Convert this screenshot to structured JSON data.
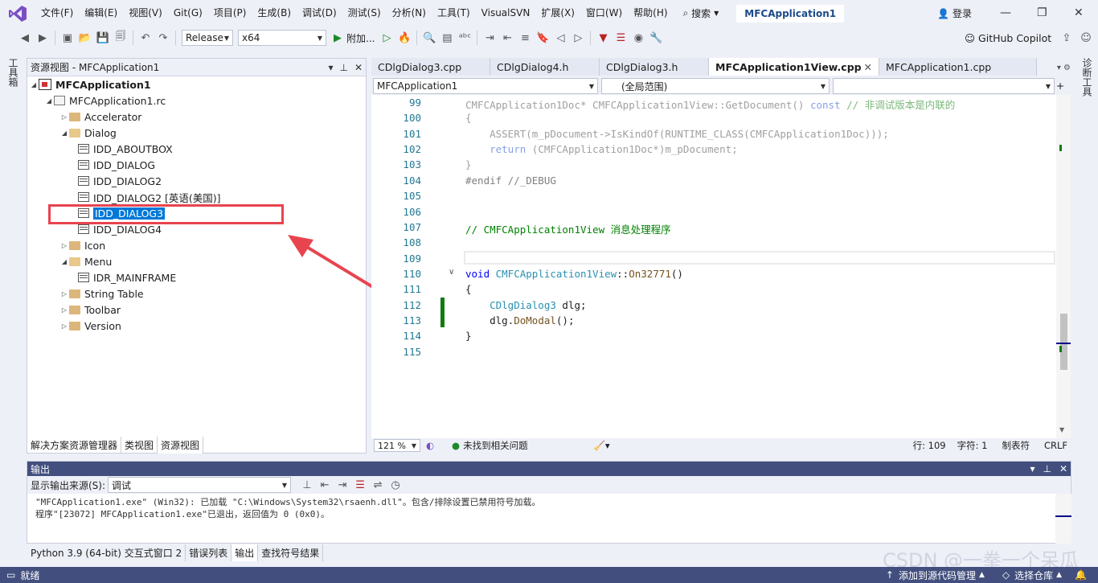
{
  "menubar": {
    "items": [
      "文件(F)",
      "编辑(E)",
      "视图(V)",
      "Git(G)",
      "项目(P)",
      "生成(B)",
      "调试(D)",
      "测试(S)",
      "分析(N)",
      "工具(T)",
      "VisualSVN",
      "扩展(X)",
      "窗口(W)",
      "帮助(H)"
    ],
    "search_label": "搜索",
    "app_title": "MFCApplication1",
    "login_label": "登录"
  },
  "toolbar": {
    "config": "Release",
    "platform": "x64",
    "attach_label": "附加...",
    "copilot_label": "GitHub Copilot"
  },
  "side": {
    "left_label": "工具箱",
    "right_label": "诊断工具"
  },
  "resource_view": {
    "title": "资源视图 - MFCApplication1",
    "tree": [
      {
        "label": "MFCApplication1",
        "icon": "project-icon"
      },
      {
        "label": "MFCApplication1.rc",
        "icon": "rc-file-icon"
      },
      {
        "label": "Accelerator",
        "icon": "folder-icon"
      },
      {
        "label": "Dialog",
        "icon": "folder-open-icon"
      },
      {
        "label": "IDD_ABOUTBOX",
        "icon": "dialog-icon"
      },
      {
        "label": "IDD_DIALOG",
        "icon": "dialog-icon"
      },
      {
        "label": "IDD_DIALOG2",
        "icon": "dialog-icon"
      },
      {
        "label": "IDD_DIALOG2 [英语(美国)]",
        "icon": "dialog-icon"
      },
      {
        "label": "IDD_DIALOG3",
        "icon": "dialog-icon"
      },
      {
        "label": "IDD_DIALOG4",
        "icon": "dialog-icon"
      },
      {
        "label": "Icon",
        "icon": "folder-icon"
      },
      {
        "label": "Menu",
        "icon": "folder-open-icon"
      },
      {
        "label": "IDR_MAINFRAME",
        "icon": "menu-icon"
      },
      {
        "label": "String Table",
        "icon": "folder-icon"
      },
      {
        "label": "Toolbar",
        "icon": "folder-icon"
      },
      {
        "label": "Version",
        "icon": "folder-icon"
      }
    ],
    "bottom_tabs": [
      "解决方案资源管理器",
      "类视图",
      "资源视图"
    ]
  },
  "editor": {
    "tabs": [
      "CDlgDialog3.cpp",
      "CDlgDialog4.h",
      "CDlgDialog3.h",
      "MFCApplication1View.cpp",
      "MFCApplication1.cpp"
    ],
    "nav_project": "MFCApplication1",
    "nav_scope": "(全局范围)",
    "line_numbers": [
      "99",
      "100",
      "101",
      "102",
      "103",
      "104",
      "105",
      "106",
      "107",
      "108",
      "109",
      "110",
      "111",
      "112",
      "113",
      "114",
      "115"
    ],
    "lines": {
      "l99a": "CMFCApplication1Doc* CMFCApplication1View::GetDocument() ",
      "l99b": "const",
      "l99c": " // 非调试版本是内联的",
      "l100": "{",
      "l101": "    ASSERT(m_pDocument->IsKindOf(RUNTIME_CLASS(CMFCApplication1Doc)));",
      "l102a": "    return",
      "l102b": " (CMFCApplication1Doc*)m_pDocument;",
      "l103": "}",
      "l104": "#endif //_DEBUG",
      "l107": "// CMFCApplication1View 消息处理程序",
      "l110a": "void",
      "l110b": " CMFCApplication1View",
      "l110c": "::",
      "l110d": "On32771",
      "l110e": "()",
      "l111": "{",
      "l112a": "    CDlgDialog3",
      "l112b": " dlg;",
      "l113a": "    dlg.",
      "l113b": "DoModal",
      "l113c": "();",
      "l114": "}"
    },
    "zoom": "121 %",
    "issues": "未找到相关问题",
    "line": "行: 109",
    "col": "字符: 1",
    "tabs_mode": "制表符",
    "eol": "CRLF"
  },
  "output": {
    "title": "输出",
    "source_label": "显示输出来源(S):",
    "source_value": "调试",
    "line1": "\"MFCApplication1.exe\" (Win32): 已加载 \"C:\\Windows\\System32\\rsaenh.dll\"。包含/排除设置已禁用符号加载。",
    "line2": "程序\"[23072] MFCApplication1.exe\"已退出，返回值为 0 (0x0)。",
    "bottom_tabs": [
      "Python 3.9 (64-bit) 交互式窗口 2",
      "错误列表",
      "输出",
      "查找符号结果"
    ]
  },
  "statusbar": {
    "ready": "就绪",
    "source_control": "添加到源代码管理",
    "repo": "选择仓库"
  },
  "watermark": "CSDN @一拳一个呆瓜"
}
